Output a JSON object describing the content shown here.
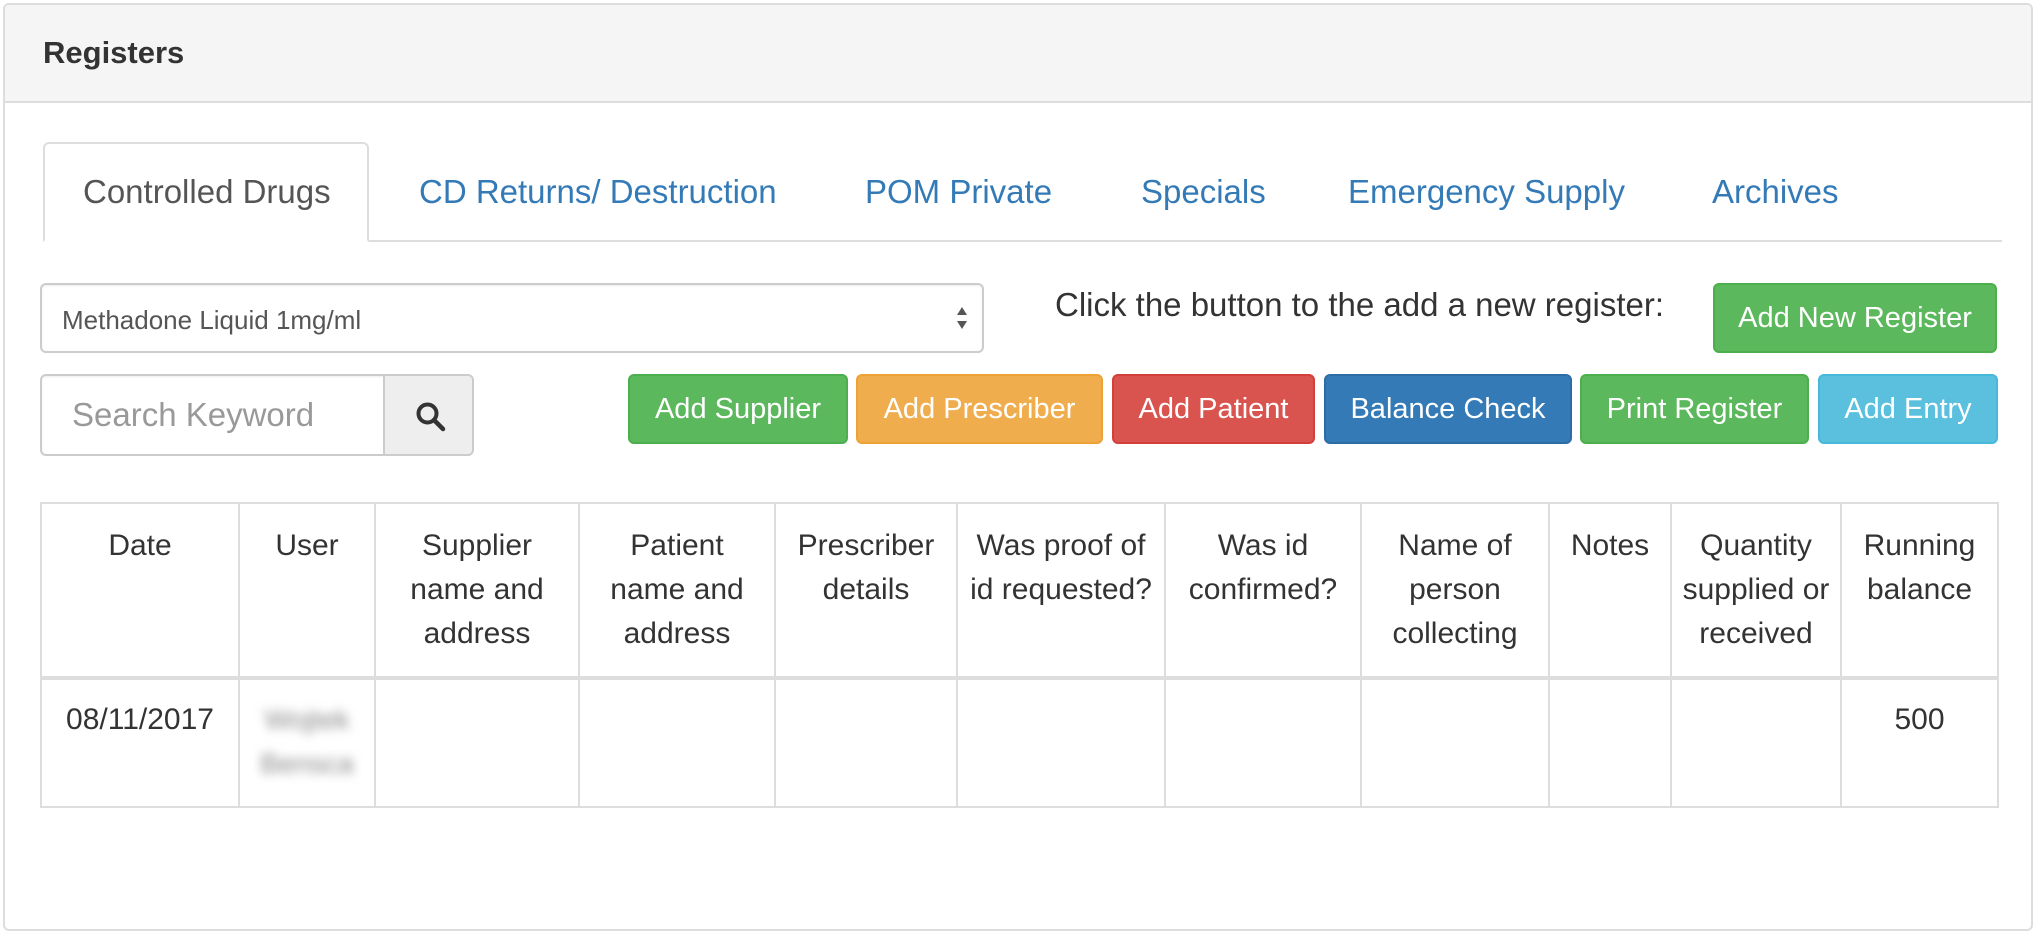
{
  "panel": {
    "title": "Registers"
  },
  "tabs": [
    {
      "label": "Controlled Drugs",
      "active": true
    },
    {
      "label": "CD Returns/ Destruction",
      "active": false
    },
    {
      "label": "POM Private",
      "active": false
    },
    {
      "label": "Specials",
      "active": false
    },
    {
      "label": "Emergency Supply",
      "active": false
    },
    {
      "label": "Archives",
      "active": false
    }
  ],
  "register_select": {
    "value": "Methadone Liquid 1mg/ml"
  },
  "add_register": {
    "prompt": "Click the button to the add a new register:",
    "button_label": "Add New Register"
  },
  "search": {
    "placeholder": "Search Keyword",
    "icon": "search-icon"
  },
  "actions": {
    "add_supplier": "Add Supplier",
    "add_prescriber": "Add Prescriber",
    "add_patient": "Add Patient",
    "balance_check": "Balance Check",
    "print_register": "Print Register",
    "add_entry": "Add Entry"
  },
  "colors": {
    "success": "#5cb85c",
    "warning": "#f0ad4e",
    "danger": "#d9534f",
    "primary": "#337ab7",
    "info": "#5bc0de",
    "link": "#337ab7"
  },
  "table": {
    "headers": [
      "Date",
      "User",
      "Supplier name and address",
      "Patient name and address",
      "Prescriber details",
      "Was proof of id requested?",
      "Was id confirmed?",
      "Name of person collecting",
      "Notes",
      "Quantity supplied or received",
      "Running balance"
    ],
    "rows": [
      [
        "08/11/2017",
        "Wojtek Bensca",
        "",
        "",
        "",
        "",
        "",
        "",
        "",
        "",
        "500"
      ]
    ]
  }
}
